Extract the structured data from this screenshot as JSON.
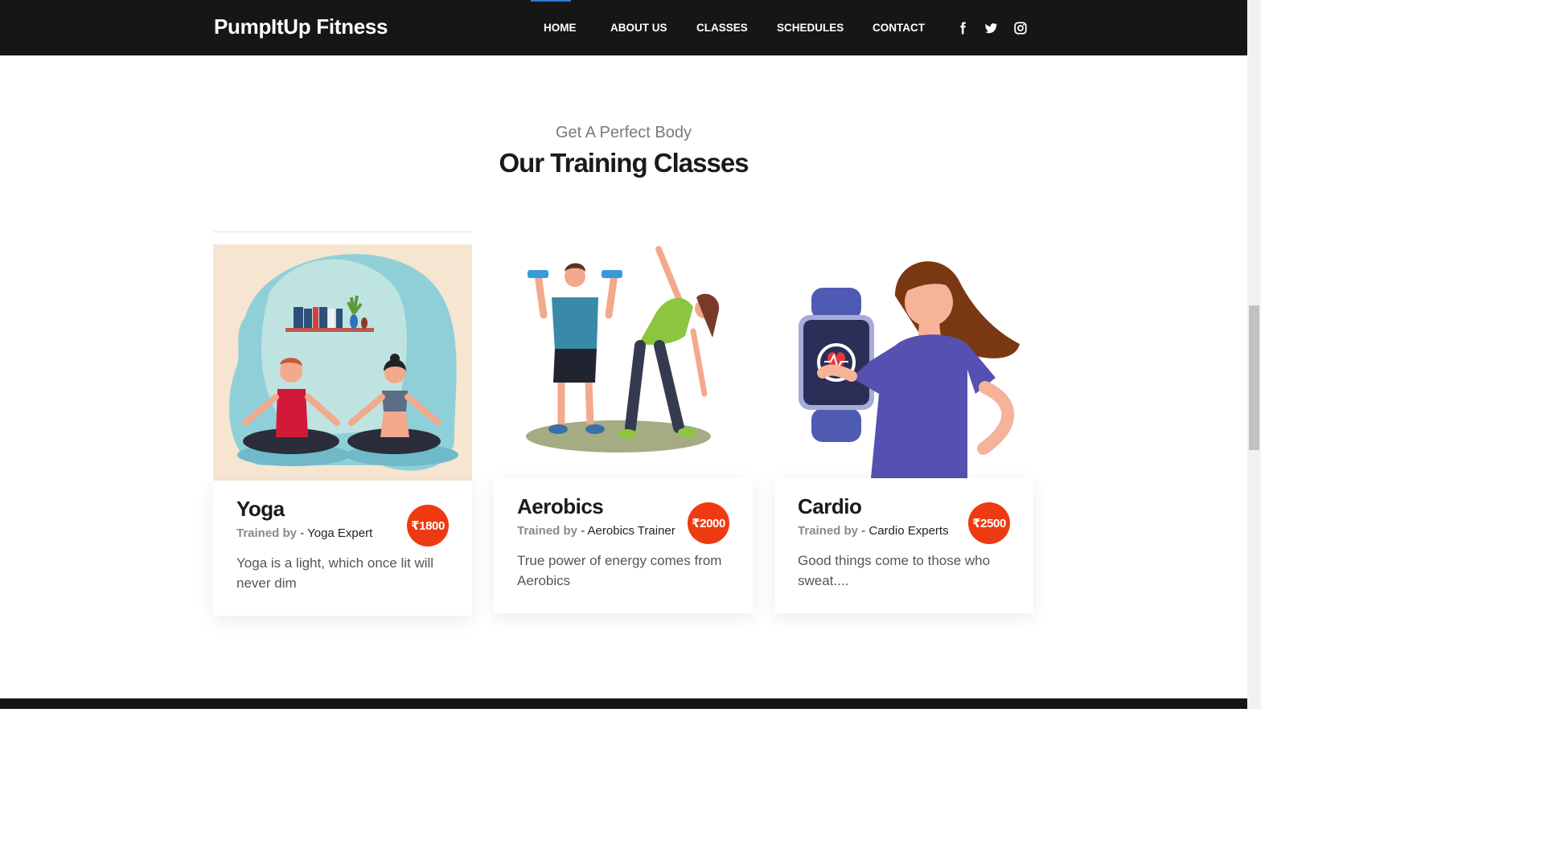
{
  "header": {
    "brand": "PumpItUp Fitness",
    "nav": [
      {
        "label": "HOME",
        "active": true
      },
      {
        "label": "ABOUT US",
        "active": false
      },
      {
        "label": "CLASSES",
        "active": false
      },
      {
        "label": "SCHEDULES",
        "active": false
      },
      {
        "label": "CONTACT",
        "active": false
      }
    ],
    "social_icons": [
      "facebook-icon",
      "twitter-icon",
      "instagram-icon"
    ]
  },
  "section": {
    "eyebrow": "Get A Perfect Body",
    "title": "Our Training Classes"
  },
  "classes": [
    {
      "name": "Yoga",
      "trained_by_label": "Trained by",
      "trainer": "- Yoga Expert",
      "price": "₹1800",
      "description": "Yoga is a light, which once lit will never dim",
      "illustration": "yoga-illustration"
    },
    {
      "name": "Aerobics",
      "trained_by_label": "Trained by",
      "trainer": "- Aerobics Trainer",
      "price": "₹2000",
      "description": "True power of energy comes from Aerobics",
      "illustration": "aerobics-illustration"
    },
    {
      "name": "Cardio",
      "trained_by_label": "Trained by",
      "trainer": "- Cardio Experts",
      "price": "₹2500",
      "description": "Good things come to those who sweat....",
      "illustration": "cardio-illustration"
    }
  ],
  "colors": {
    "header_bg": "#161616",
    "accent_price": "#ee3a12",
    "active_indicator": "#2f7ad1",
    "muted_text": "#7a7a7a"
  }
}
